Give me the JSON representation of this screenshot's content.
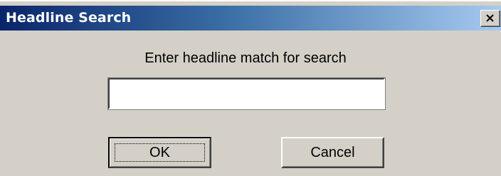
{
  "window": {
    "title": "Headline Search",
    "close_icon": "close-icon"
  },
  "dialog": {
    "prompt": "Enter headline match for search",
    "search_value": "",
    "search_placeholder": ""
  },
  "buttons": {
    "ok_label": "OK",
    "cancel_label": "Cancel"
  },
  "colors": {
    "titlebar_start": "#0a246a",
    "titlebar_end": "#a6caf0",
    "face": "#d4d0c8"
  }
}
